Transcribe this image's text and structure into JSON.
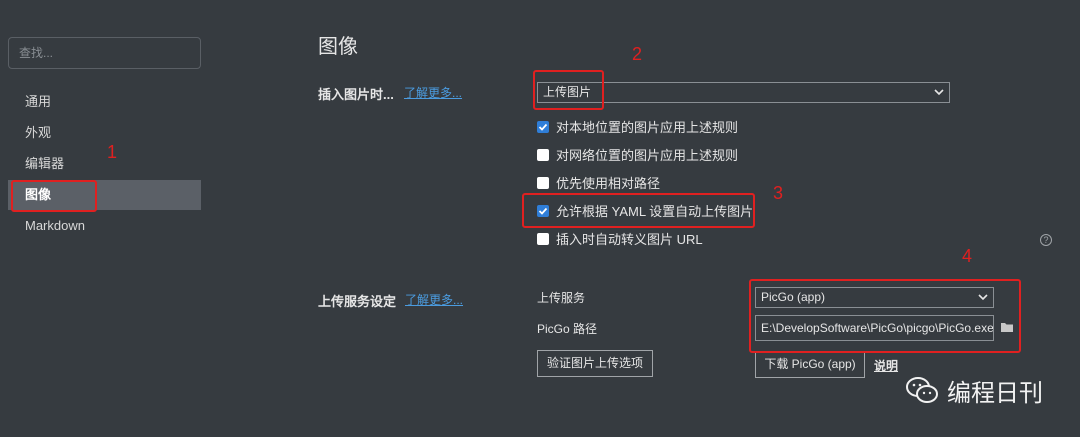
{
  "sidebar": {
    "search_placeholder": "查找...",
    "items": [
      {
        "label": "通用"
      },
      {
        "label": "外观"
      },
      {
        "label": "编辑器"
      },
      {
        "label": "图像",
        "active": true
      },
      {
        "label": "Markdown"
      }
    ]
  },
  "main": {
    "section_title": "图像",
    "insert_image": {
      "label": "插入图片时...",
      "learn_more": "了解更多...",
      "select_value": "上传图片",
      "options": [
        {
          "label": "对本地位置的图片应用上述规则",
          "checked": true
        },
        {
          "label": "对网络位置的图片应用上述规则",
          "checked": false
        },
        {
          "label": "优先使用相对路径",
          "checked": false
        },
        {
          "label": "允许根据 YAML 设置自动上传图片",
          "checked": true
        },
        {
          "label": "插入时自动转义图片 URL",
          "checked": false
        }
      ]
    },
    "upload_service": {
      "label": "上传服务设定",
      "learn_more": "了解更多...",
      "service_label": "上传服务",
      "service_value": "PicGo (app)",
      "path_label": "PicGo 路径",
      "path_value": "E:\\DevelopSoftware\\PicGo\\picgo\\PicGo.exe",
      "verify_button": "验证图片上传选项",
      "download_button": "下载 PicGo (app)",
      "help_link": "说明"
    }
  },
  "annotations": [
    "1",
    "2",
    "3",
    "4"
  ],
  "help_icon": "?",
  "watermark": "编程日刊",
  "colors": {
    "background": "#363b40",
    "accent": "#2f7ed8",
    "link": "#4b9ce0",
    "annotation": "#e02020",
    "active_nav": "#5b6067"
  }
}
